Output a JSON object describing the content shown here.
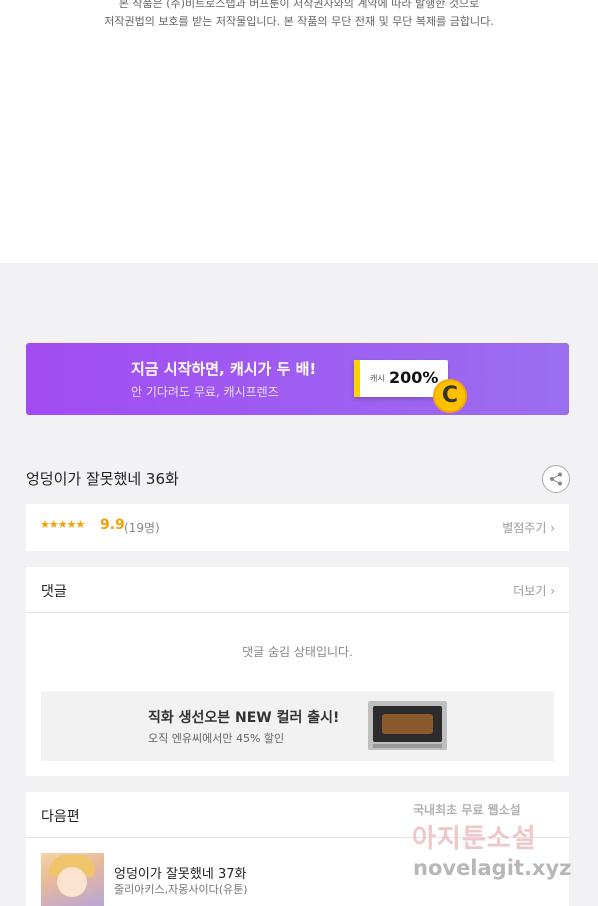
{
  "copyright": {
    "line1": "본 작품은 (주)비트로스탭과 버프툰이 저작권자와의 계약에 따라 발행한 것으로",
    "line2": "저작권법의 보호를 받는 저작물입니다. 본 작품의 무단 전재 및 무단 복제를 금합니다."
  },
  "banner": {
    "title": "지금 시작하면, 캐시가 두 배!",
    "subtitle": "안 기다려도 무료, 캐시프렌즈",
    "cash_label": "캐시",
    "cash_value": "200%",
    "coin_letter": "C",
    "gradient": [
      "#a24bf2",
      "#9b6ef0"
    ]
  },
  "episode": {
    "title": "엉덩이가 잘못했네 36화",
    "share_icon": "share-icon"
  },
  "rating": {
    "stars": "★★★★★",
    "score": "9.9",
    "count": "(19명)",
    "rate_link": "별점주기 ›",
    "star_color": "#f5a000"
  },
  "comments": {
    "title": "댓글",
    "more_link": "더보기 ›",
    "hidden_message": "댓글 숨김 상태입니다."
  },
  "ad": {
    "title": "직화 생선오븐 NEW 컬러 출시!",
    "subtitle": "오직 엔유씨에서만 45% 할인"
  },
  "next_episode": {
    "section_title": "다음편",
    "title": "엉덩이가 잘못했네 37화",
    "author": "줄리아키스,자몽사이다(유툰)"
  },
  "watermark": {
    "line1": "국내최초 무료 웹소설",
    "line2": "아지툰소설",
    "line3": "novelagit.xyz"
  }
}
